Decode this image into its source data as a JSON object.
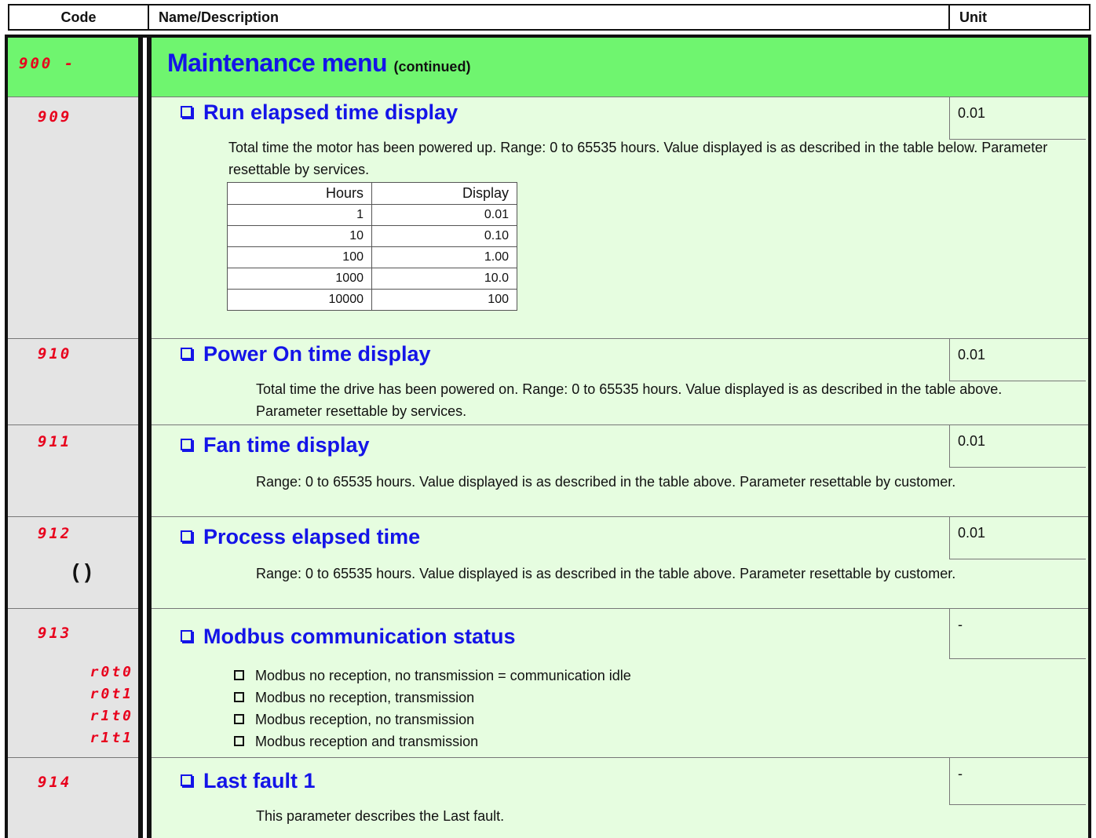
{
  "header": {
    "code": "Code",
    "name": "Name/Description",
    "unit": "Unit"
  },
  "menu": {
    "code": "900 -",
    "title": "Maintenance menu",
    "continued": "(continued)"
  },
  "params": [
    {
      "code": "909",
      "title": "Run elapsed time display",
      "unit": "0.01",
      "description": "Total time the motor has been powered up. Range: 0 to 65535 hours. Value displayed is as described in the table below. Parameter resettable by services.",
      "table": {
        "headers": [
          "Hours",
          "Display"
        ],
        "rows": [
          [
            "1",
            "0.01"
          ],
          [
            "10",
            "0.10"
          ],
          [
            "100",
            "1.00"
          ],
          [
            "1000",
            "10.0"
          ],
          [
            "10000",
            "100"
          ]
        ]
      }
    },
    {
      "code": "910",
      "title": "Power On time display",
      "unit": "0.01",
      "description": "Total time the drive has been powered on. Range: 0 to 65535 hours. Value displayed is as described in the table above. Parameter resettable by services."
    },
    {
      "code": "911",
      "title": "Fan time display",
      "unit": "0.01",
      "description": "Range: 0 to 65535 hours. Value displayed is as described in the table above. Parameter resettable by customer."
    },
    {
      "code": "912",
      "title": "Process elapsed time",
      "unit": "0.01",
      "icon": "cycle-icon",
      "icon_glyph": "( )",
      "description": "Range: 0 to 65535 hours. Value displayed is as described in the table above. Parameter resettable by customer."
    },
    {
      "code": "913",
      "title": "Modbus communication status",
      "unit": "-",
      "options": [
        {
          "code": "r0t0",
          "label": "Modbus no reception, no transmission = communication idle"
        },
        {
          "code": "r0t1",
          "label": "Modbus no reception, transmission"
        },
        {
          "code": "r1t0",
          "label": "Modbus reception, no transmission"
        },
        {
          "code": "r1t1",
          "label": "Modbus reception and transmission"
        }
      ]
    },
    {
      "code": "914",
      "title": "Last fault 1",
      "unit": "-",
      "description": "This parameter describes the Last fault."
    }
  ],
  "colors": {
    "menu_green": "#6ff56f",
    "row_green": "#e6fde0",
    "code_gray": "#e4e4e4",
    "title_blue": "#1414e8",
    "code_red": "#e8001c"
  }
}
